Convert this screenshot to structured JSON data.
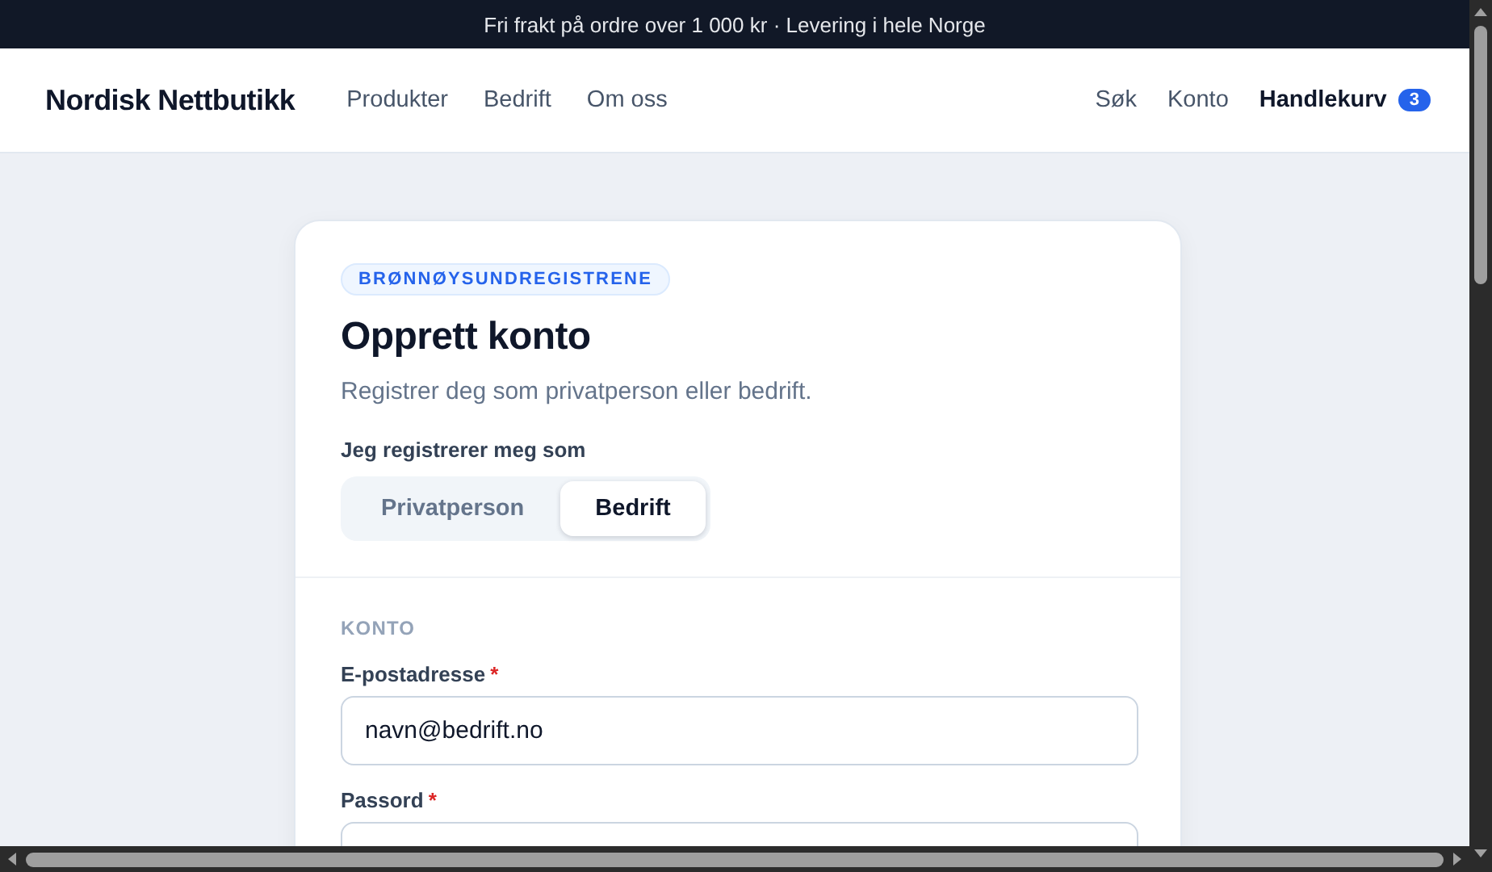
{
  "banner": {
    "text": "Fri frakt på ordre over 1 000 kr · Levering i hele Norge"
  },
  "header": {
    "logo": "Nordisk Nettbutikk",
    "nav": [
      {
        "label": "Produkter"
      },
      {
        "label": "Bedrift"
      },
      {
        "label": "Om oss"
      }
    ],
    "actions": [
      {
        "kind": "link",
        "label": "Søk"
      },
      {
        "kind": "link",
        "label": "Konto"
      },
      {
        "kind": "cart",
        "label": "Handlekurv",
        "count": "3"
      }
    ]
  },
  "card": {
    "badge": "BRØNNØYSUNDREGISTRENE",
    "title": "Opprett konto",
    "subtitle": "Registrer deg som privatperson eller bedrift.",
    "type_label": "Jeg registrerer meg som",
    "account_types": [
      {
        "label": "Privatperson",
        "selected": false
      },
      {
        "label": "Bedrift",
        "selected": true
      }
    ],
    "section": "KONTO",
    "fields": [
      {
        "label": "E-postadresse",
        "required_mark": "*",
        "value": "navn@bedrift.no"
      },
      {
        "label": "Passord",
        "required_mark": "*"
      }
    ]
  }
}
